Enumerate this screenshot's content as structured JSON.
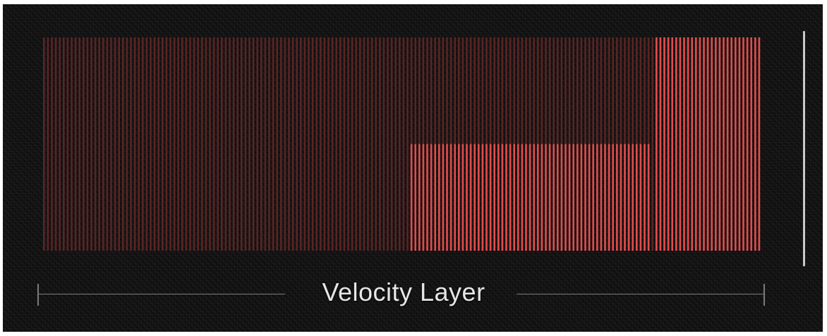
{
  "velocity_layer": {
    "label": "Velocity Layer",
    "accent_color": "#e14c4c",
    "inactive_color": "#5a2424",
    "layers": [
      {
        "velocity_start": 0.0,
        "velocity_end": 0.51,
        "level": 0.0
      },
      {
        "velocity_start": 0.51,
        "velocity_end": 0.845,
        "level": 0.5
      },
      {
        "velocity_start": 0.845,
        "velocity_end": 1.0,
        "level": 1.0
      }
    ]
  }
}
